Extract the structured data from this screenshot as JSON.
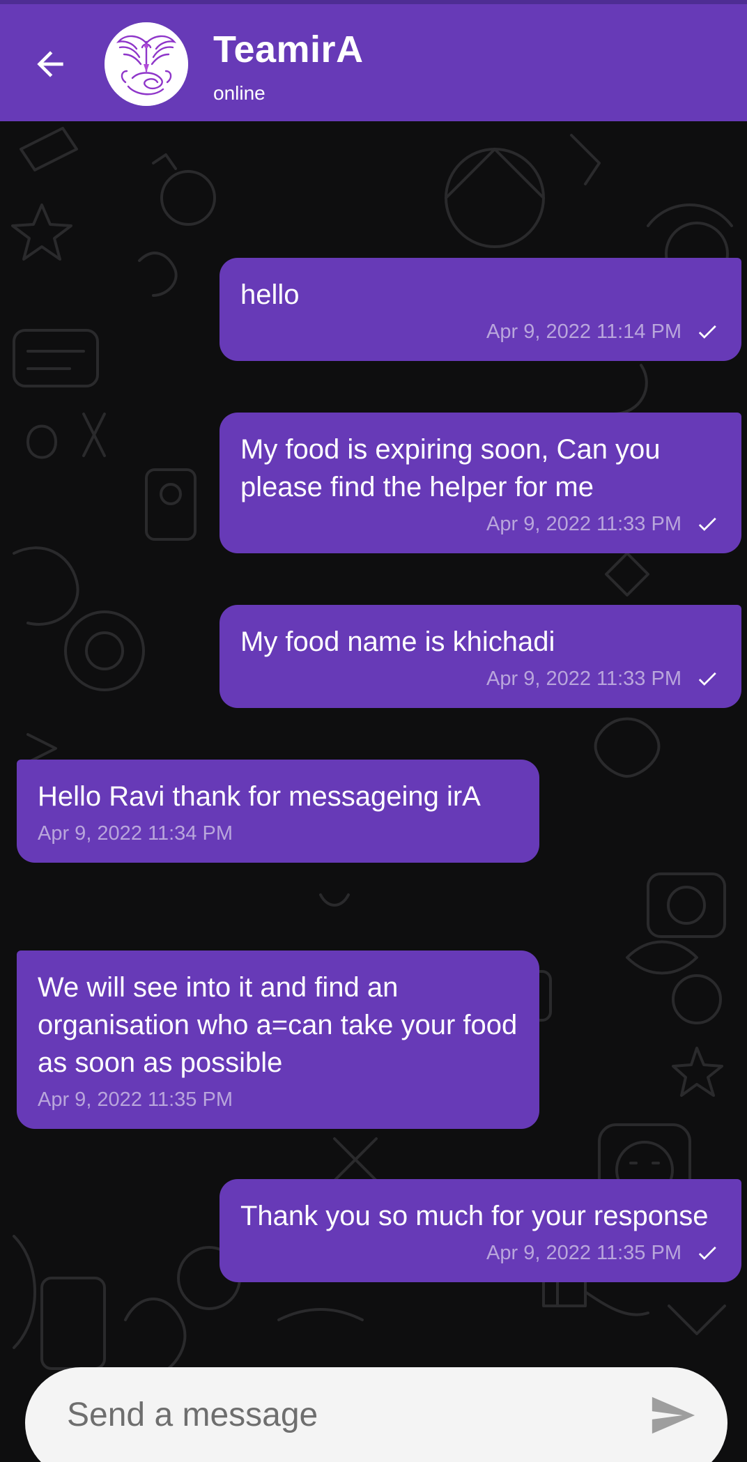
{
  "header": {
    "contact_name": "TeamirA",
    "status": "online",
    "back_icon": "arrow-left-icon",
    "avatar_icon": "phoenix-logo",
    "color": "#673ab7"
  },
  "messages": [
    {
      "direction": "outgoing",
      "text": "hello",
      "time": "Apr 9, 2022 11:14 PM",
      "read_icon": "check-icon"
    },
    {
      "direction": "outgoing",
      "text": "My food is expiring soon, Can you please find the helper for me",
      "time": "Apr 9, 2022 11:33 PM",
      "read_icon": "check-icon"
    },
    {
      "direction": "outgoing",
      "text": "My food name is khichadi",
      "time": "Apr 9, 2022 11:33 PM",
      "read_icon": "check-icon"
    },
    {
      "direction": "incoming",
      "text": "Hello Ravi thank for messageing irA",
      "time": "Apr 9, 2022 11:34 PM"
    },
    {
      "direction": "incoming",
      "text": "We will see into it and find an organisation who a=can take your food as soon as possible",
      "time": "Apr 9, 2022 11:35 PM"
    },
    {
      "direction": "outgoing",
      "text": "Thank you so much for your response",
      "time": "Apr 9, 2022 11:35 PM",
      "read_icon": "check-icon"
    }
  ],
  "composer": {
    "placeholder": "Send a message",
    "value": "",
    "send_icon": "send-icon"
  },
  "colors": {
    "accent": "#673ab7",
    "chat_background": "#0e0e0f",
    "composer_background": "#f4f4f4"
  }
}
